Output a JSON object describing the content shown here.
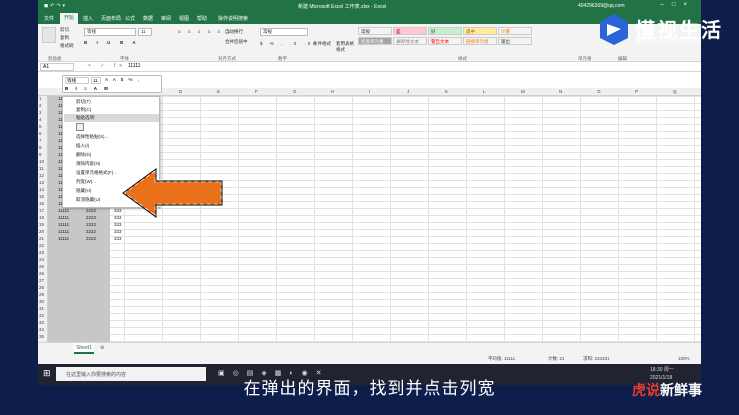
{
  "window": {
    "title": "新建 Microsoft Excel 工作表.xlsx - Excel",
    "account": "404296369@qq.com"
  },
  "tabs": [
    "文件",
    "开始",
    "插入",
    "页面布局",
    "公式",
    "数据",
    "审阅",
    "视图",
    "帮助",
    "操作说明搜索"
  ],
  "ribbon": {
    "clipboard": [
      "剪切",
      "复制",
      "格式刷"
    ],
    "font_name": "等线",
    "font_size": "11",
    "align": [
      "自动换行",
      "合并后居中"
    ],
    "number_format": "常规",
    "styles_buttons": [
      "条件格式",
      "套用表格格式"
    ],
    "cell_styles": [
      {
        "label": "常规",
        "bg": "#ffffff",
        "fg": "#000000"
      },
      {
        "label": "差",
        "bg": "#ffc7ce",
        "fg": "#9c0006"
      },
      {
        "label": "好",
        "bg": "#c6efce",
        "fg": "#006100"
      },
      {
        "label": "适中",
        "bg": "#ffeb9c",
        "fg": "#9c5700"
      },
      {
        "label": "计算",
        "bg": "#f2f2f2",
        "fg": "#fa7d00"
      },
      {
        "label": "检查单元格",
        "bg": "#a5a5a5",
        "fg": "#ffffff"
      },
      {
        "label": "解释性文本",
        "bg": "#ffffff",
        "fg": "#7f7f7f"
      },
      {
        "label": "警告文本",
        "bg": "#ffffff",
        "fg": "#ff0000"
      },
      {
        "label": "链接单元格",
        "bg": "#ffffff",
        "fg": "#fa7d00"
      },
      {
        "label": "输出",
        "bg": "#f2f2f2",
        "fg": "#3f3f3f"
      }
    ],
    "groups": [
      "剪贴板",
      "字体",
      "对齐方式",
      "数字",
      "样式",
      "单元格",
      "编辑"
    ]
  },
  "formula_bar": {
    "name_box": "A1",
    "content": "11111"
  },
  "columns": [
    "A",
    "B",
    "C",
    "D",
    "E",
    "F",
    "G",
    "H",
    "I",
    "J",
    "K",
    "L",
    "M",
    "N",
    "O",
    "P",
    "Q",
    "R"
  ],
  "rows": [
    "1",
    "2",
    "3",
    "4",
    "5",
    "6",
    "7",
    "8",
    "9",
    "10",
    "11",
    "12",
    "13",
    "14",
    "15",
    "16",
    "17",
    "18",
    "19",
    "20",
    "21",
    "22",
    "23",
    "24",
    "25",
    "26",
    "27",
    "28",
    "29",
    "30",
    "31",
    "32",
    "33",
    "34",
    "35"
  ],
  "cell_values": {
    "a": "11111",
    "b": "2222",
    "c": "333"
  },
  "mini_toolbar": {
    "font": "等线",
    "size": "11"
  },
  "context_menu": [
    "剪切(T)",
    "复制(C)",
    "粘贴选项:",
    "",
    "选择性粘贴(S)...",
    "插入(I)",
    "删除(D)",
    "清除内容(N)",
    "设置单元格格式(F)...",
    "列宽(W)...",
    "隐藏(H)",
    "取消隐藏(U)"
  ],
  "sheet": {
    "tab": "Sheet1"
  },
  "status": {
    "avg": "平均值: 11111",
    "count": "计数: 21",
    "sum": "求和: 233331",
    "zoom": "100%"
  },
  "taskbar": {
    "search": "在这里输入你要搜索的内容",
    "time": "18:30 周一",
    "date": "2021/1/18"
  },
  "subtitle": "在弹出的界面，找到并点击列宽",
  "brand": {
    "part1": "虎说",
    "part2": "新鲜事"
  },
  "logo": {
    "cn": "懂视生活",
    "en": "SIDUNGSHI.COM"
  },
  "colors": {
    "excel_green": "#217346",
    "arrow_orange": "#e8711a",
    "brand_red": "#e83a2f",
    "brand_white": "#ffffff"
  }
}
